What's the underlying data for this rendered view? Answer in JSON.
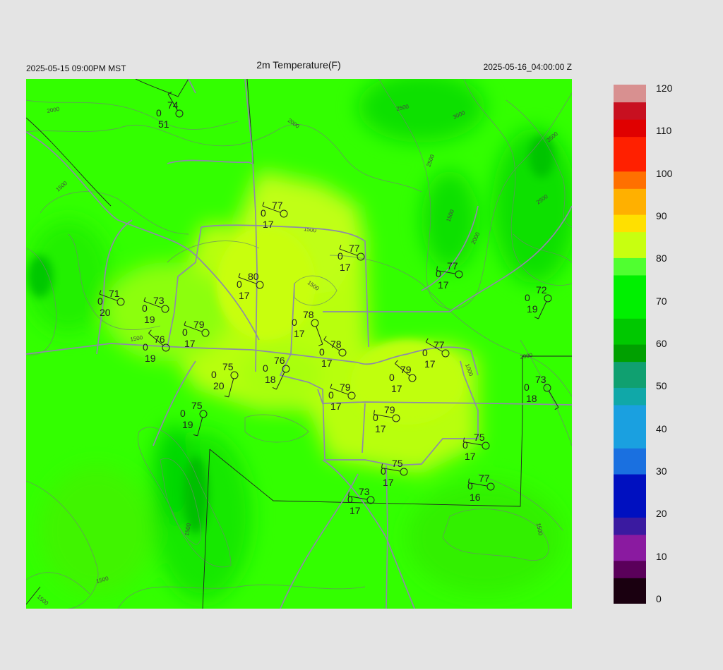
{
  "header": {
    "title": "2m Temperature(F)",
    "local_time": "2025-05-15 09:00PM MST",
    "utc_time": "2025-05-16_04:00:00 Z"
  },
  "colorbar": {
    "ticks": [
      "120",
      "110",
      "100",
      "90",
      "80",
      "70",
      "60",
      "50",
      "40",
      "30",
      "20",
      "10",
      "0"
    ],
    "range": [
      0,
      120
    ],
    "stops": [
      {
        "v": 0,
        "c": "#1a0010"
      },
      {
        "v": 5,
        "c": "#5a005a"
      },
      {
        "v": 10,
        "c": "#8a1aa0"
      },
      {
        "v": 15,
        "c": "#3a1aa0"
      },
      {
        "v": 20,
        "c": "#0010c0"
      },
      {
        "v": 30,
        "c": "#1a70e0"
      },
      {
        "v": 35,
        "c": "#1aa0e0"
      },
      {
        "v": 45,
        "c": "#10a8a8"
      },
      {
        "v": 50,
        "c": "#10a070"
      },
      {
        "v": 55,
        "c": "#00a000"
      },
      {
        "v": 60,
        "c": "#00c800"
      },
      {
        "v": 65,
        "c": "#00f000"
      },
      {
        "v": 75,
        "c": "#50ff30"
      },
      {
        "v": 80,
        "c": "#c8ff10"
      },
      {
        "v": 85,
        "c": "#ffe000"
      },
      {
        "v": 90,
        "c": "#ffb000"
      },
      {
        "v": 95,
        "c": "#ff7000"
      },
      {
        "v": 100,
        "c": "#ff2000"
      },
      {
        "v": 107,
        "c": "#e00000"
      },
      {
        "v": 112,
        "c": "#c81020"
      },
      {
        "v": 116,
        "c": "#d89090"
      },
      {
        "v": 120,
        "c": "#d0d0d0"
      }
    ]
  },
  "contour_labels": [
    "2000",
    "2000",
    "2500",
    "3000",
    "3500",
    "2500",
    "2500",
    "2000",
    "1500",
    "1500",
    "1500",
    "1500",
    "1000",
    "1500",
    "2000",
    "1500",
    "1500",
    "1500",
    "1500"
  ],
  "stations": [
    {
      "temp": "74",
      "q": "0",
      "dew": "51"
    },
    {
      "temp": "77",
      "q": "0",
      "dew": "17"
    },
    {
      "temp": "77",
      "q": "0",
      "dew": "17"
    },
    {
      "temp": "77",
      "q": "0",
      "dew": "17"
    },
    {
      "temp": "80",
      "q": "0",
      "dew": "17"
    },
    {
      "temp": "71",
      "q": "0",
      "dew": "20"
    },
    {
      "temp": "73",
      "q": "0",
      "dew": "19"
    },
    {
      "temp": "72",
      "q": "0",
      "dew": "19"
    },
    {
      "temp": "78",
      "q": "0",
      "dew": "17"
    },
    {
      "temp": "79",
      "q": "0",
      "dew": "17"
    },
    {
      "temp": "76",
      "q": "0",
      "dew": "19"
    },
    {
      "temp": "78",
      "q": "0",
      "dew": "17"
    },
    {
      "temp": "77",
      "q": "0",
      "dew": "17"
    },
    {
      "temp": "76",
      "q": "0",
      "dew": "18"
    },
    {
      "temp": "75",
      "q": "0",
      "dew": "20"
    },
    {
      "temp": "79",
      "q": "0",
      "dew": "17"
    },
    {
      "temp": "73",
      "q": "0",
      "dew": "18"
    },
    {
      "temp": "79",
      "q": "0",
      "dew": "17"
    },
    {
      "temp": "75",
      "q": "0",
      "dew": "19"
    },
    {
      "temp": "79",
      "q": "0",
      "dew": "17"
    },
    {
      "temp": "75",
      "q": "0",
      "dew": "17"
    },
    {
      "temp": "75",
      "q": "0",
      "dew": "17"
    },
    {
      "temp": "77",
      "q": "0",
      "dew": "16"
    },
    {
      "temp": "73",
      "q": "0",
      "dew": "17"
    }
  ]
}
